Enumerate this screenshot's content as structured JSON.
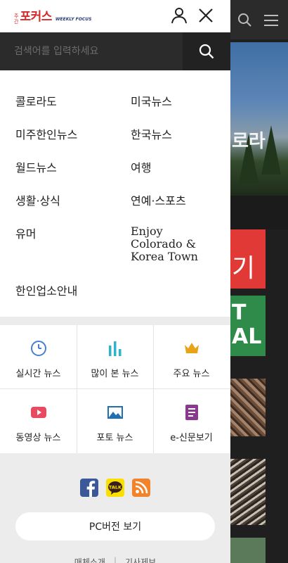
{
  "header": {
    "logo_small_top": "주",
    "logo_small_bottom": "간",
    "logo_main": "포커스",
    "logo_sub": "WEEKLY FOCUS"
  },
  "search": {
    "placeholder": "검색어를 입력하세요"
  },
  "menu": {
    "items": [
      "콜로라도",
      "미국뉴스",
      "미주한인뉴스",
      "한국뉴스",
      "월드뉴스",
      "여행",
      "생활·상식",
      "연예·스포츠",
      "유머",
      "Enjoy\nColorado &\nKorea Town",
      "한인업소안내"
    ]
  },
  "news_categories": [
    {
      "label": "실시간 뉴스",
      "icon": "clock-icon",
      "color": "#4a7fd0"
    },
    {
      "label": "많이 본 뉴스",
      "icon": "bar-chart-icon",
      "color": "#2bb5c8"
    },
    {
      "label": "주요 뉴스",
      "icon": "crown-icon",
      "color": "#e8a317"
    },
    {
      "label": "동영상 뉴스",
      "icon": "play-icon",
      "color": "#e84a5f"
    },
    {
      "label": "포토 뉴스",
      "icon": "photo-icon",
      "color": "#1f6fb2"
    },
    {
      "label": "e-신문보기",
      "icon": "document-icon",
      "color": "#8a3a8e"
    }
  ],
  "footer": {
    "social": [
      {
        "name": "facebook-icon",
        "color": "#3b5998"
      },
      {
        "name": "kakaotalk-icon",
        "color": "#f9e000",
        "label": "TALK"
      },
      {
        "name": "rss-icon",
        "color": "#f2832a"
      }
    ],
    "pc_version_label": "PC버전 보기",
    "links": [
      "매체소개",
      "기사제보"
    ]
  },
  "background": {
    "photo_text": "로라",
    "red_banner_text": "기",
    "green_banner_text_1": "T",
    "green_banner_text_2": "AL"
  }
}
